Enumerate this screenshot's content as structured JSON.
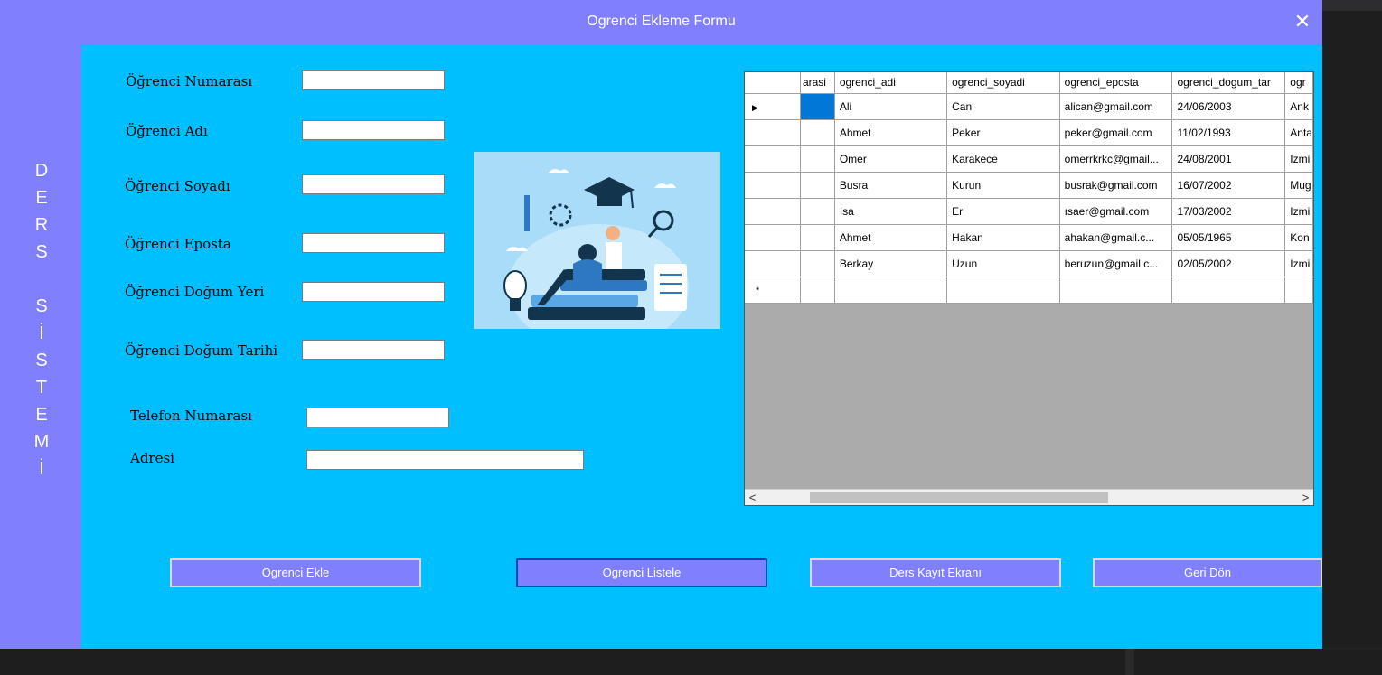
{
  "window": {
    "title": "Ogrenci Ekleme Formu",
    "close_label": "✕"
  },
  "sidebar": {
    "vertical_text": "D\nE\nR\nS\n\nS\nİ\nS\nT\nE\nM\nİ"
  },
  "form": {
    "student_number_label": "Öğrenci Numarası",
    "first_name_label": "Öğrenci Adı",
    "last_name_label": "Öğrenci Soyadı",
    "email_label": "Öğrenci Eposta",
    "birthplace_label": "Öğrenci Doğum Yeri",
    "birthdate_label": "Öğrenci Doğum Tarihi",
    "phone_label": "Telefon Numarası",
    "address_label": "Adresi"
  },
  "grid": {
    "columns": [
      "arasi",
      "ogrenci_adi",
      "ogrenci_soyadi",
      "ogrenci_eposta",
      "ogrenci_dogum_tar",
      "ogr"
    ],
    "rows": [
      [
        "",
        "Ali",
        "Can",
        "alican@gmail.com",
        "24/06/2003",
        "Ank"
      ],
      [
        "",
        "Ahmet",
        "Peker",
        "peker@gmail.com",
        "11/02/1993",
        "Anta"
      ],
      [
        "",
        "Omer",
        "Karakece",
        "omerrkrkc@gmail...",
        "24/08/2001",
        "Izmi"
      ],
      [
        "",
        "Busra",
        "Kurun",
        "busrak@gmail.com",
        "16/07/2002",
        "Mug"
      ],
      [
        "",
        "Isa",
        "Er",
        "ısaer@gmail.com",
        "17/03/2002",
        "Izmi"
      ],
      [
        "",
        "Ahmet",
        "Hakan",
        "ahakan@gmail.c...",
        "05/05/1965",
        "Kon"
      ],
      [
        "",
        "Berkay",
        "Uzun",
        "beruzun@gmail.c...",
        "02/05/2002",
        "Izmi"
      ]
    ],
    "current_row_marker": "▶",
    "new_row_marker": "*",
    "scroll_left": "<",
    "scroll_right": ">"
  },
  "buttons": {
    "add": "Ogrenci Ekle",
    "list": "Ogrenci Listele",
    "course_registration": "Ders Kayıt Ekranı",
    "back": "Geri Dön"
  },
  "colors": {
    "titlebar": "#8080ff",
    "content_bg": "#00bfff",
    "button_bg": "#8080ff",
    "grid_empty": "#ababab",
    "selection": "#0078d7"
  }
}
